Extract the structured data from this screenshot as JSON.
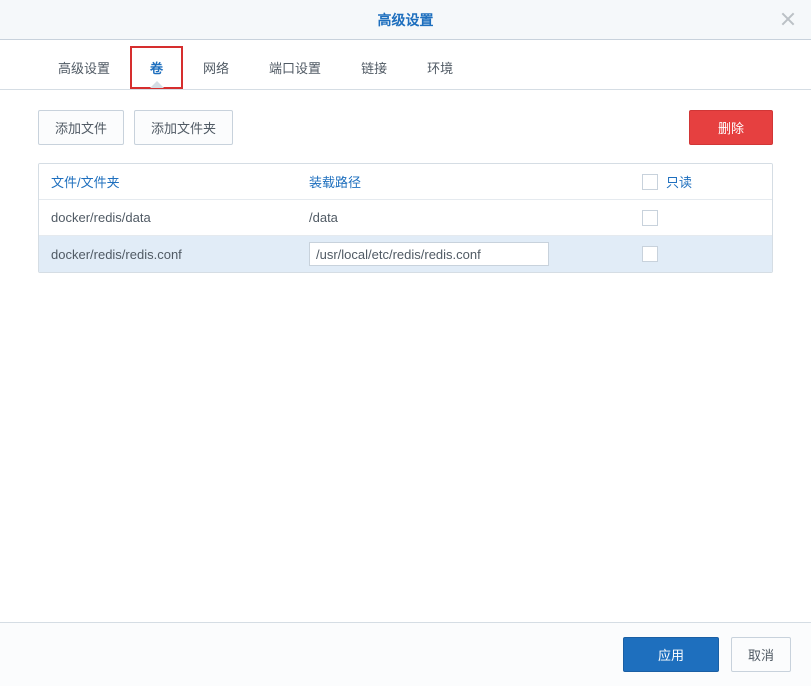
{
  "header": {
    "title": "高级设置"
  },
  "tabs": [
    {
      "label": "高级设置",
      "active": false,
      "highlighted": false
    },
    {
      "label": "卷",
      "active": true,
      "highlighted": true
    },
    {
      "label": "网络",
      "active": false,
      "highlighted": false
    },
    {
      "label": "端口设置",
      "active": false,
      "highlighted": false
    },
    {
      "label": "链接",
      "active": false,
      "highlighted": false
    },
    {
      "label": "环境",
      "active": false,
      "highlighted": false
    }
  ],
  "toolbar": {
    "add_file_label": "添加文件",
    "add_folder_label": "添加文件夹",
    "delete_label": "删除"
  },
  "table": {
    "headers": {
      "file": "文件/文件夹",
      "mount": "装载路径",
      "readonly": "只读"
    },
    "rows": [
      {
        "file": "docker/redis/data",
        "mount": "/data",
        "readonly": false,
        "editing": false,
        "selected": false
      },
      {
        "file": "docker/redis/redis.conf",
        "mount": "/usr/local/etc/redis/redis.conf",
        "readonly": false,
        "editing": true,
        "selected": true
      }
    ]
  },
  "footer": {
    "apply_label": "应用",
    "cancel_label": "取消"
  }
}
